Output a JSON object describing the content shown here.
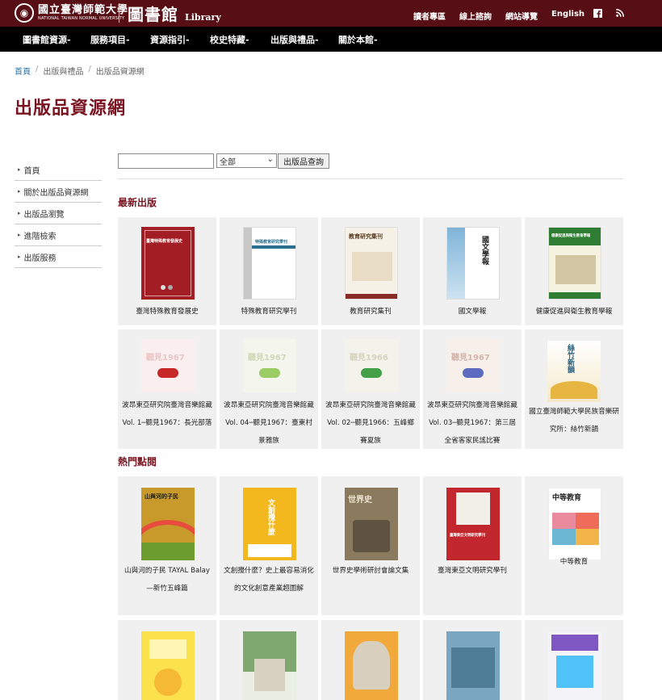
{
  "header": {
    "university_zh": "國立臺灣師範大學",
    "university_en": "NATIONAL TAIWAN NORMAL UNIVERSITY",
    "library_zh": "圖書館",
    "library_en": "Library",
    "links": [
      "讀者專區",
      "線上諮詢",
      "網站導覽",
      "English"
    ],
    "icons": [
      "facebook-icon",
      "rss-icon"
    ]
  },
  "nav": {
    "items": [
      "圖書館資源",
      "服務項目",
      "資源指引",
      "校史特藏",
      "出版與禮品",
      "關於本館"
    ]
  },
  "breadcrumb": [
    "首頁",
    "出版與禮品",
    "出版品資源網"
  ],
  "page_title": "出版品資源網",
  "sidebar": {
    "items": [
      "首頁",
      "關於出版品資源網",
      "出版品瀏覽",
      "進階檢索",
      "出版服務"
    ]
  },
  "search": {
    "value": "",
    "select_value": "全部",
    "button": "出版品查詢"
  },
  "sections": {
    "latest": "最新出版",
    "popular": "熱門點閱"
  },
  "latest": [
    {
      "title": "臺灣特殊教育發展史",
      "cover_text": "臺灣特殊教育發展史"
    },
    {
      "title": "特殊教育研究學刊",
      "cover_text": "特殊教育研究學刊"
    },
    {
      "title": "教育研究集刊",
      "cover_text": "教育研究集刊"
    },
    {
      "title": "國文學報",
      "cover_text": "國文學報"
    },
    {
      "title": "健康促進與衛生教育學報",
      "cover_text": "健康促進與衛生教育學報"
    },
    {
      "title": "波昂東亞研究院臺灣音樂館藏Vol. 1─聽見1967：長光部落",
      "cover_text": "聽見1967"
    },
    {
      "title": "波昂東亞研究院臺灣音樂館藏Vol. 04─聽見1967：臺東村景雅族",
      "cover_text": "聽見1967"
    },
    {
      "title": "波昂東亞研究院臺灣音樂館藏Vol. 02─聽見1966：五峰鄉賽夏族",
      "cover_text": "聽見1966"
    },
    {
      "title": "波昂東亞研究院臺灣音樂館藏Vol. 03─聽見1967：第三屆全省客家民謠比賽",
      "cover_text": "聽見1967"
    },
    {
      "title": "國立臺灣師範大學民族音樂研究所：絲竹新韻",
      "cover_text": "絲竹新韻"
    }
  ],
  "popular": [
    {
      "title": "山與河的子民 TAYAL Balay—新竹五峰篇",
      "cover_text": "山與河的子民"
    },
    {
      "title": "文創攪什麼？史上最容易消化的文化創意產業超圖解",
      "cover_text": "文創攪什麼"
    },
    {
      "title": "世界史學術研討會論文集",
      "cover_text": "世界史"
    },
    {
      "title": "臺灣東亞文明研究學刊",
      "cover_text": "臺灣東亞文明研究學刊"
    },
    {
      "title": "中等教育",
      "cover_text": "中等教育"
    }
  ],
  "colors": {
    "topbar": "#570e14",
    "nav": "#000000",
    "accent": "#7a1420"
  }
}
